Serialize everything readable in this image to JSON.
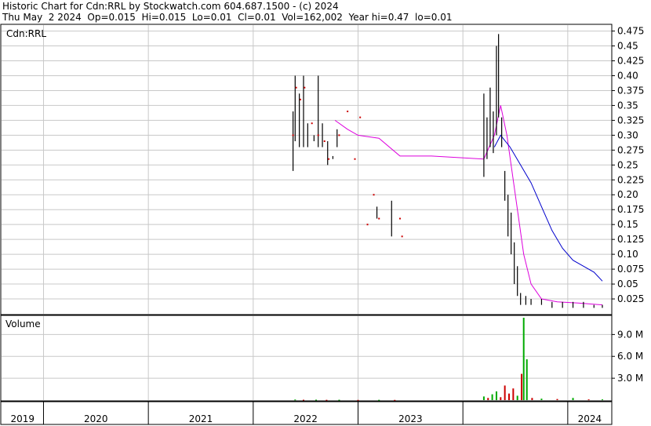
{
  "header": {
    "line1": "Historic Chart for Cdn:RRL by Stockwatch.com 604.687.1500 - (c) 2024",
    "line2": "Thu May  2 2024  Op=0.015  Hi=0.015  Lo=0.01  Cl=0.01  Vol=162,002  Year hi=0.47  lo=0.01"
  },
  "colors": {
    "price_bar": "#000000",
    "close_tick": "#cc0000",
    "ma_short": "#dd00dd",
    "ma_long": "#0000cc",
    "volume_up": "#00aa00",
    "volume_down": "#cc0000",
    "grid": "#c8c8c8"
  },
  "chart_data": [
    {
      "type": "line",
      "title": "Cdn:RRL",
      "y_ticks": [
        "0.475",
        "0.45",
        "0.425",
        "0.40",
        "0.375",
        "0.35",
        "0.325",
        "0.30",
        "0.275",
        "0.25",
        "0.225",
        "0.20",
        "0.175",
        "0.15",
        "0.125",
        "0.10",
        "0.075",
        "0.05",
        "0.025"
      ],
      "ylim": [
        0.0,
        0.485
      ],
      "xlim": [
        2018.6,
        2024.42
      ],
      "x_ticks": [
        "2019",
        "2020",
        "2021",
        "2022",
        "2023",
        "2024"
      ],
      "price_bars": [
        {
          "x": 2021.38,
          "lo": 0.24,
          "hi": 0.34
        },
        {
          "x": 2021.4,
          "lo": 0.29,
          "hi": 0.4
        },
        {
          "x": 2021.44,
          "lo": 0.28,
          "hi": 0.37
        },
        {
          "x": 2021.48,
          "lo": 0.28,
          "hi": 0.4
        },
        {
          "x": 2021.52,
          "lo": 0.28,
          "hi": 0.32
        },
        {
          "x": 2021.58,
          "lo": 0.29,
          "hi": 0.3
        },
        {
          "x": 2021.62,
          "lo": 0.28,
          "hi": 0.4
        },
        {
          "x": 2021.66,
          "lo": 0.28,
          "hi": 0.32
        },
        {
          "x": 2021.71,
          "lo": 0.25,
          "hi": 0.29
        },
        {
          "x": 2021.76,
          "lo": 0.26,
          "hi": 0.265
        },
        {
          "x": 2021.8,
          "lo": 0.28,
          "hi": 0.31
        },
        {
          "x": 2022.18,
          "lo": 0.16,
          "hi": 0.18
        },
        {
          "x": 2022.32,
          "lo": 0.13,
          "hi": 0.19
        },
        {
          "x": 2023.2,
          "lo": 0.23,
          "hi": 0.37
        },
        {
          "x": 2023.23,
          "lo": 0.26,
          "hi": 0.33
        },
        {
          "x": 2023.26,
          "lo": 0.28,
          "hi": 0.38
        },
        {
          "x": 2023.29,
          "lo": 0.27,
          "hi": 0.34
        },
        {
          "x": 2023.32,
          "lo": 0.3,
          "hi": 0.45
        },
        {
          "x": 2023.34,
          "lo": 0.33,
          "hi": 0.47
        },
        {
          "x": 2023.37,
          "lo": 0.28,
          "hi": 0.33
        },
        {
          "x": 2023.4,
          "lo": 0.19,
          "hi": 0.24
        },
        {
          "x": 2023.43,
          "lo": 0.13,
          "hi": 0.2
        },
        {
          "x": 2023.46,
          "lo": 0.1,
          "hi": 0.17
        },
        {
          "x": 2023.49,
          "lo": 0.05,
          "hi": 0.12
        },
        {
          "x": 2023.52,
          "lo": 0.03,
          "hi": 0.08
        },
        {
          "x": 2023.55,
          "lo": 0.015,
          "hi": 0.035
        },
        {
          "x": 2023.6,
          "lo": 0.015,
          "hi": 0.03
        },
        {
          "x": 2023.65,
          "lo": 0.015,
          "hi": 0.025
        },
        {
          "x": 2023.75,
          "lo": 0.015,
          "hi": 0.025
        },
        {
          "x": 2023.85,
          "lo": 0.01,
          "hi": 0.02
        },
        {
          "x": 2023.95,
          "lo": 0.01,
          "hi": 0.02
        },
        {
          "x": 2024.05,
          "lo": 0.01,
          "hi": 0.02
        },
        {
          "x": 2024.15,
          "lo": 0.01,
          "hi": 0.02
        },
        {
          "x": 2024.25,
          "lo": 0.01,
          "hi": 0.015
        },
        {
          "x": 2024.33,
          "lo": 0.01,
          "hi": 0.015
        }
      ],
      "close_ticks": [
        {
          "x": 2021.38,
          "y": 0.3
        },
        {
          "x": 2021.41,
          "y": 0.38
        },
        {
          "x": 2021.45,
          "y": 0.36
        },
        {
          "x": 2021.49,
          "y": 0.38
        },
        {
          "x": 2021.56,
          "y": 0.32
        },
        {
          "x": 2021.62,
          "y": 0.3
        },
        {
          "x": 2021.68,
          "y": 0.29
        },
        {
          "x": 2021.72,
          "y": 0.26
        },
        {
          "x": 2021.82,
          "y": 0.3
        },
        {
          "x": 2021.9,
          "y": 0.34
        },
        {
          "x": 2021.97,
          "y": 0.26
        },
        {
          "x": 2022.02,
          "y": 0.33
        },
        {
          "x": 2022.09,
          "y": 0.15
        },
        {
          "x": 2022.15,
          "y": 0.2
        },
        {
          "x": 2022.2,
          "y": 0.16
        },
        {
          "x": 2022.4,
          "y": 0.16
        },
        {
          "x": 2022.42,
          "y": 0.13
        }
      ],
      "series": [
        {
          "points": [
            [
              2021.78,
              0.325
            ],
            [
              2021.9,
              0.31
            ],
            [
              2022.0,
              0.3
            ],
            [
              2022.2,
              0.295
            ],
            [
              2022.4,
              0.265
            ],
            [
              2022.7,
              0.265
            ],
            [
              2023.2,
              0.26
            ],
            [
              2023.3,
              0.3
            ],
            [
              2023.36,
              0.35
            ],
            [
              2023.42,
              0.3
            ],
            [
              2023.5,
              0.2
            ],
            [
              2023.58,
              0.1
            ],
            [
              2023.65,
              0.05
            ],
            [
              2023.75,
              0.025
            ],
            [
              2023.9,
              0.02
            ],
            [
              2024.1,
              0.018
            ],
            [
              2024.33,
              0.015
            ]
          ]
        },
        {
          "points": [
            [
              2023.3,
              0.28
            ],
            [
              2023.36,
              0.3
            ],
            [
              2023.45,
              0.28
            ],
            [
              2023.55,
              0.25
            ],
            [
              2023.65,
              0.22
            ],
            [
              2023.75,
              0.18
            ],
            [
              2023.85,
              0.14
            ],
            [
              2023.95,
              0.11
            ],
            [
              2024.05,
              0.09
            ],
            [
              2024.15,
              0.08
            ],
            [
              2024.25,
              0.07
            ],
            [
              2024.33,
              0.055
            ]
          ]
        }
      ]
    },
    {
      "type": "bar",
      "title": "Volume",
      "y_ticks": [
        "9.0 M",
        "6.0 M",
        "3.0 M"
      ],
      "ylim": [
        0,
        11.3
      ],
      "xlim": [
        2018.6,
        2024.42
      ],
      "bars": [
        {
          "x": 2021.4,
          "v": 0.08,
          "up": true
        },
        {
          "x": 2021.48,
          "v": 0.05,
          "up": false
        },
        {
          "x": 2021.6,
          "v": 0.06,
          "up": true
        },
        {
          "x": 2021.7,
          "v": 0.04,
          "up": false
        },
        {
          "x": 2021.82,
          "v": 0.05,
          "up": true
        },
        {
          "x": 2022.0,
          "v": 0.03,
          "up": false
        },
        {
          "x": 2022.2,
          "v": 0.04,
          "up": true
        },
        {
          "x": 2022.35,
          "v": 0.03,
          "up": false
        },
        {
          "x": 2023.2,
          "v": 0.5,
          "up": true
        },
        {
          "x": 2023.24,
          "v": 0.3,
          "up": false
        },
        {
          "x": 2023.28,
          "v": 0.8,
          "up": true
        },
        {
          "x": 2023.32,
          "v": 1.2,
          "up": true
        },
        {
          "x": 2023.36,
          "v": 0.4,
          "up": false
        },
        {
          "x": 2023.4,
          "v": 2.0,
          "up": false
        },
        {
          "x": 2023.44,
          "v": 0.9,
          "up": false
        },
        {
          "x": 2023.48,
          "v": 1.6,
          "up": false
        },
        {
          "x": 2023.52,
          "v": 0.6,
          "up": true
        },
        {
          "x": 2023.56,
          "v": 3.6,
          "up": false
        },
        {
          "x": 2023.58,
          "v": 11.3,
          "up": true
        },
        {
          "x": 2023.61,
          "v": 5.6,
          "up": true
        },
        {
          "x": 2023.66,
          "v": 0.3,
          "up": false
        },
        {
          "x": 2023.75,
          "v": 0.2,
          "up": true
        },
        {
          "x": 2023.9,
          "v": 0.15,
          "up": false
        },
        {
          "x": 2024.05,
          "v": 0.3,
          "up": true
        },
        {
          "x": 2024.2,
          "v": 0.1,
          "up": false
        },
        {
          "x": 2024.33,
          "v": 0.1,
          "up": true
        }
      ]
    }
  ]
}
